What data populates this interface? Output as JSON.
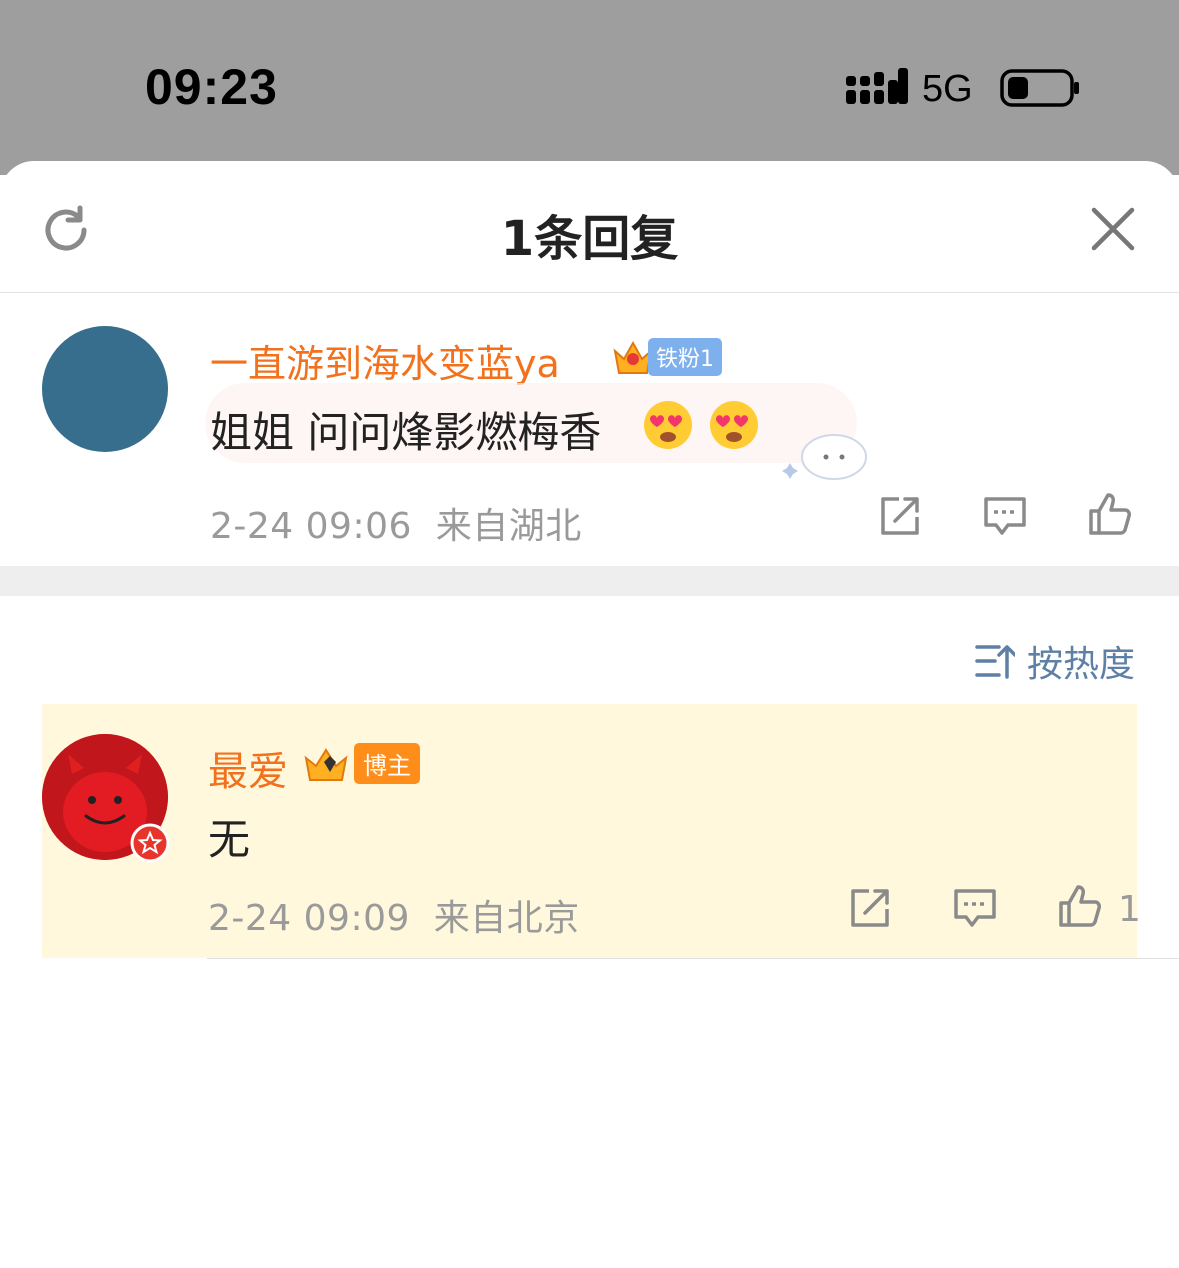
{
  "status_bar": {
    "time": "09:23",
    "network": "5G"
  },
  "sheet": {
    "title": "1条回复"
  },
  "root_comment": {
    "username": "一直游到海水变蓝ya",
    "fan_badge": "铁粉1",
    "text": "姐姐 问问烽影燃梅香",
    "emoji": [
      "heart-eyes-emoji",
      "heart-eyes-emoji"
    ],
    "timestamp": "2-24 09:06",
    "location": "来自湖北"
  },
  "sort": {
    "label": "按热度"
  },
  "replies": [
    {
      "username": "最爱",
      "badge": "博主",
      "text": "无",
      "timestamp": "2-24 09:09",
      "location": "来自北京",
      "likes": "1"
    }
  ],
  "colors": {
    "username": "#f2711c",
    "highlight_bg": "#fff8dc",
    "avatar_blue": "#376e8e",
    "sort": "#5e7fa6"
  }
}
